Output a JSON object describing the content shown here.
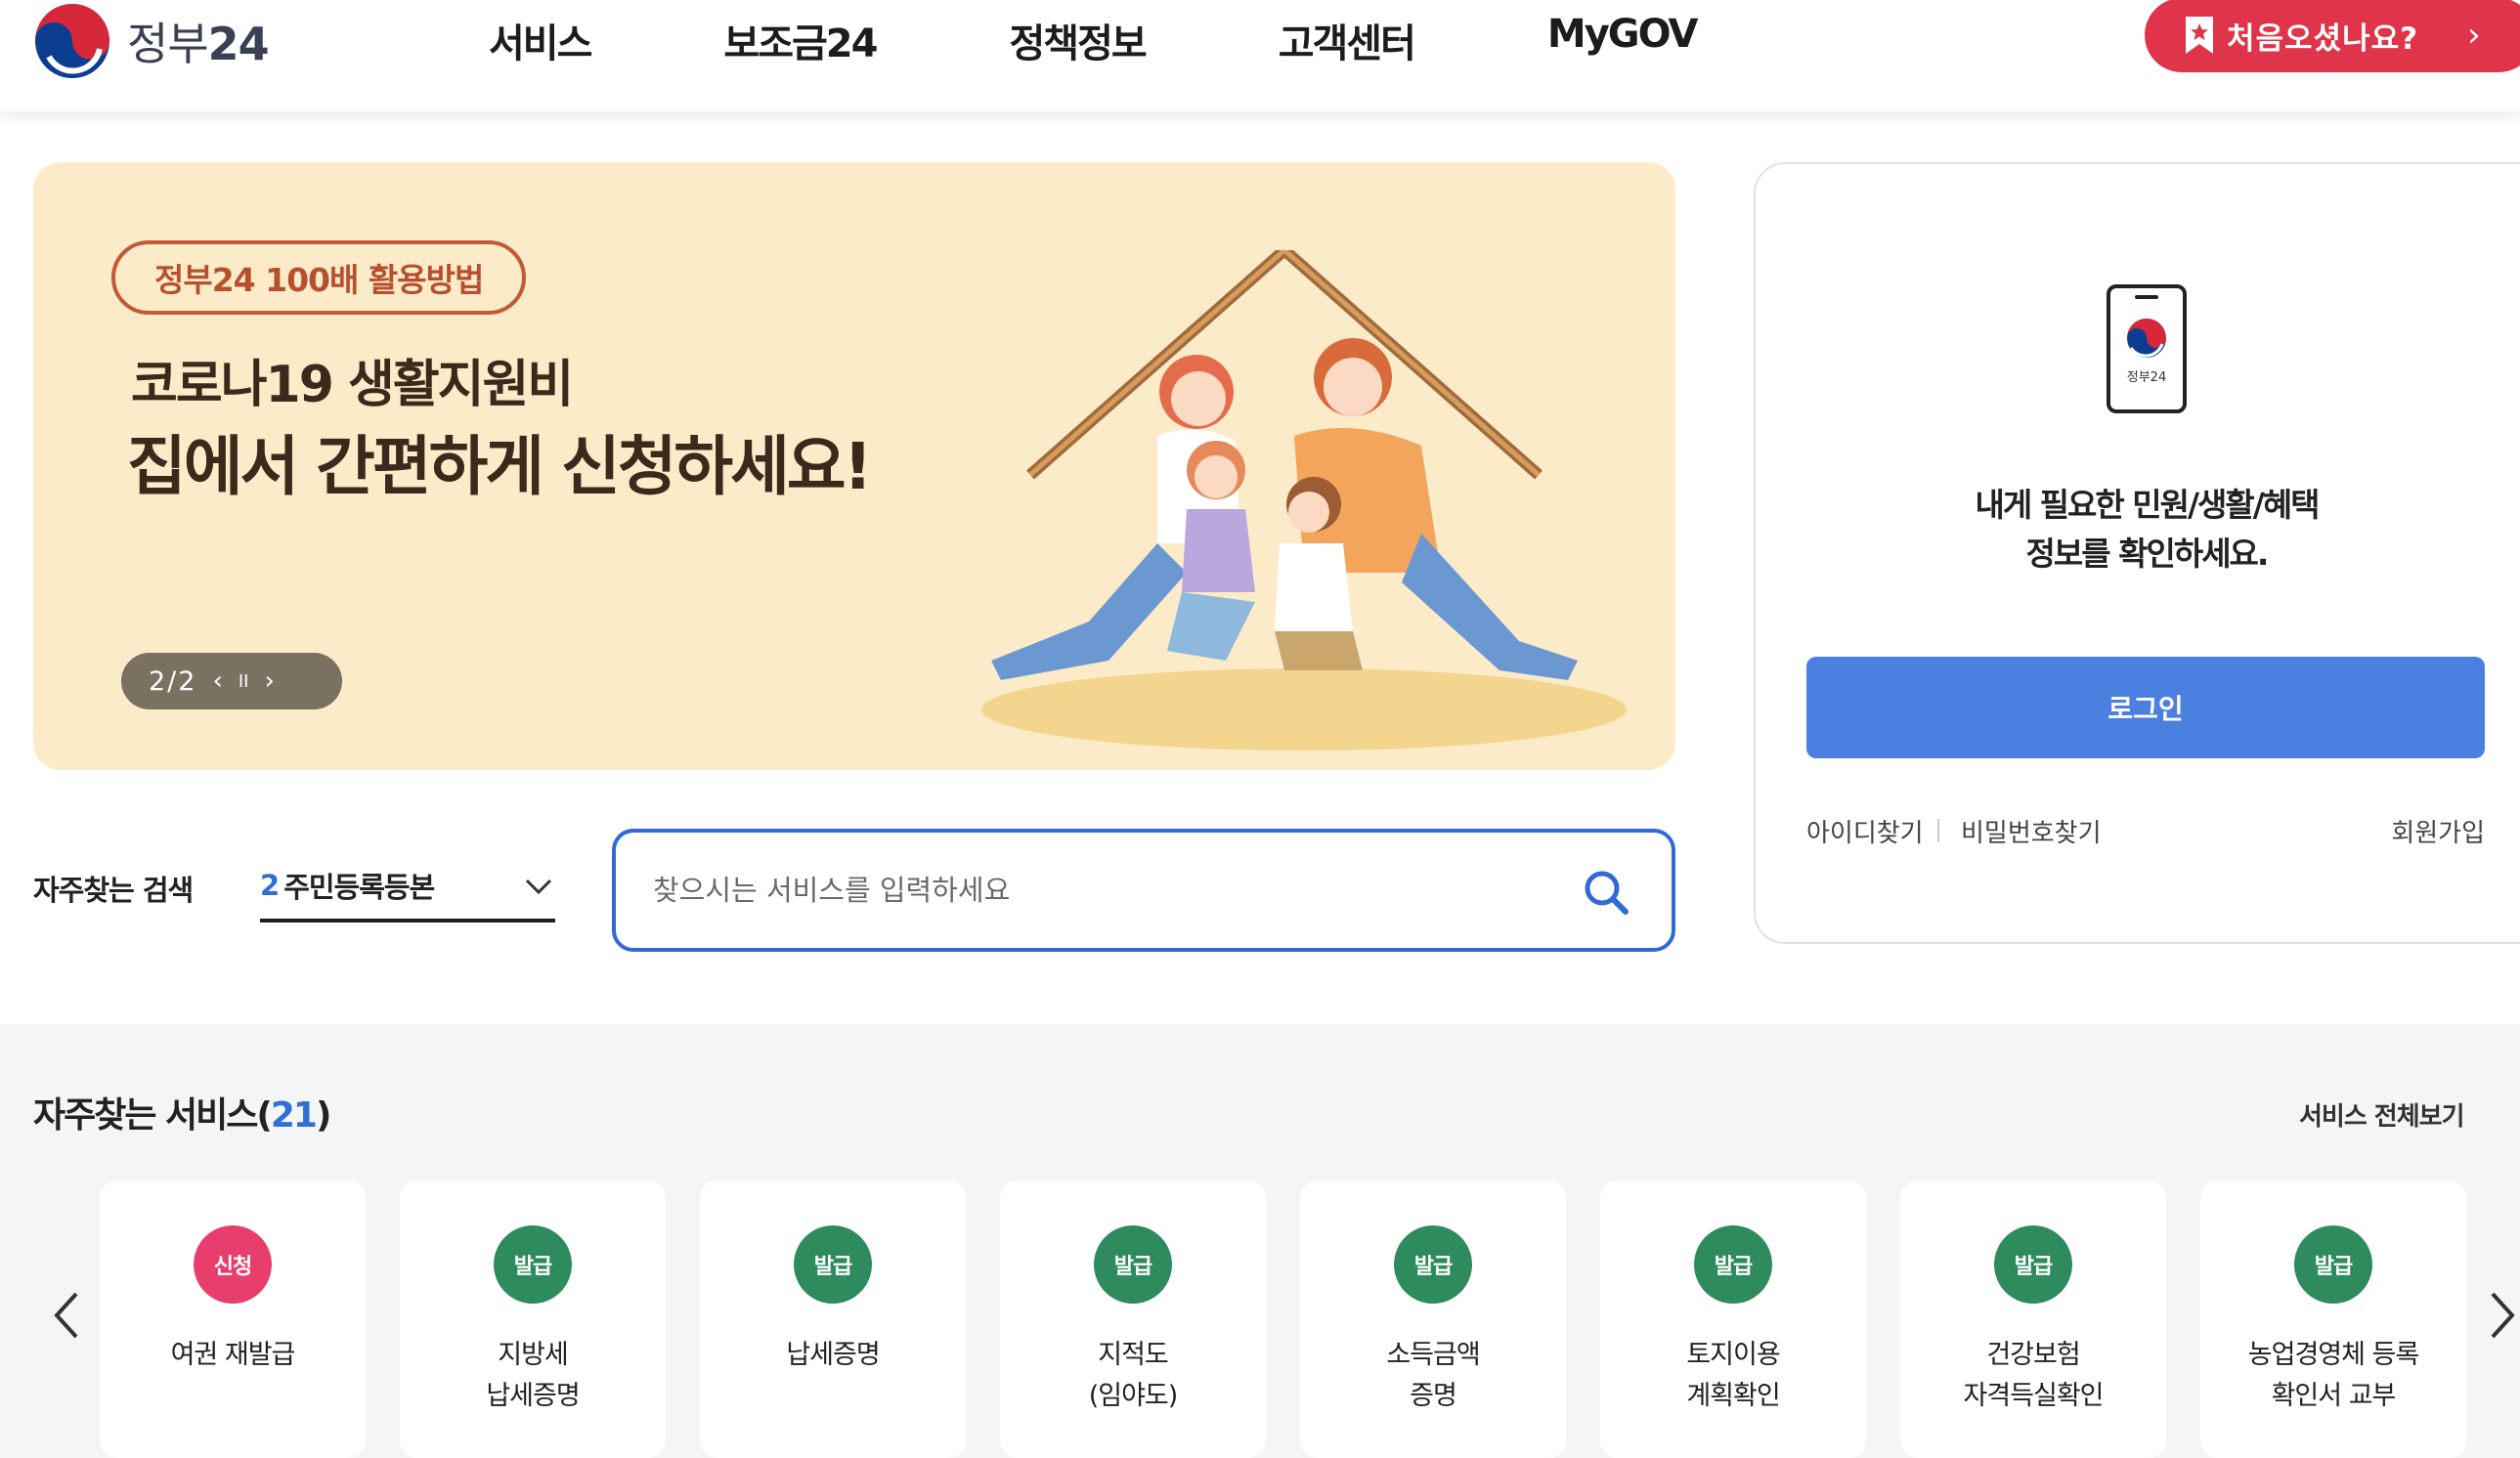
{
  "header": {
    "logo_text_a": "정부",
    "logo_text_b": "24",
    "nav": [
      "서비스",
      "보조금24",
      "정책정보",
      "고객센터",
      "MyGOV"
    ],
    "first_visit_label": "처음오셨나요?",
    "first_visit_arrow": "›"
  },
  "banner": {
    "tag": "정부24 100배 활용방법",
    "line1": "코로나19 생활지원비",
    "line2": "집에서 간편하게 신청하세요!",
    "slide_count": "2/2",
    "prev_icon": "‹",
    "pause_icon": "II",
    "next_icon": "›",
    "bg_color": "#fcebc9"
  },
  "search": {
    "freq_label": "자주찾는 검색",
    "freq_rank": "2",
    "freq_term": "주민등록등본",
    "placeholder": "찾으시는 서비스를 입력하세요",
    "accent_color": "#2f6ad6"
  },
  "login": {
    "app_label": "정부24",
    "message_line1": "내게 필요한 민원/생활/혜택",
    "message_line2": "정보를 확인하세요.",
    "login_button": "로그인",
    "find_id": "아이디찾기",
    "find_pw": "비밀번호찾기",
    "join": "회원가입",
    "button_color": "#4b7fe0"
  },
  "services": {
    "title": "자주찾는 서비스(",
    "count": "21",
    "title_end": ")",
    "view_all": "서비스 전체보기",
    "items": [
      {
        "badge": "신청",
        "badge_color": "#e83e6e",
        "line1": "여권 재발급",
        "line2": ""
      },
      {
        "badge": "발급",
        "badge_color": "#2e8b5e",
        "line1": "지방세",
        "line2": "납세증명"
      },
      {
        "badge": "발급",
        "badge_color": "#2e8b5e",
        "line1": "납세증명",
        "line2": ""
      },
      {
        "badge": "발급",
        "badge_color": "#2e8b5e",
        "line1": "지적도",
        "line2": "(임야도)"
      },
      {
        "badge": "발급",
        "badge_color": "#2e8b5e",
        "line1": "소득금액",
        "line2": "증명"
      },
      {
        "badge": "발급",
        "badge_color": "#2e8b5e",
        "line1": "토지이용",
        "line2": "계획확인"
      },
      {
        "badge": "발급",
        "badge_color": "#2e8b5e",
        "line1": "건강보험",
        "line2": "자격득실확인"
      },
      {
        "badge": "발급",
        "badge_color": "#2e8b5e",
        "line1": "농업경영체 등록",
        "line2": "확인서 교부"
      }
    ]
  }
}
